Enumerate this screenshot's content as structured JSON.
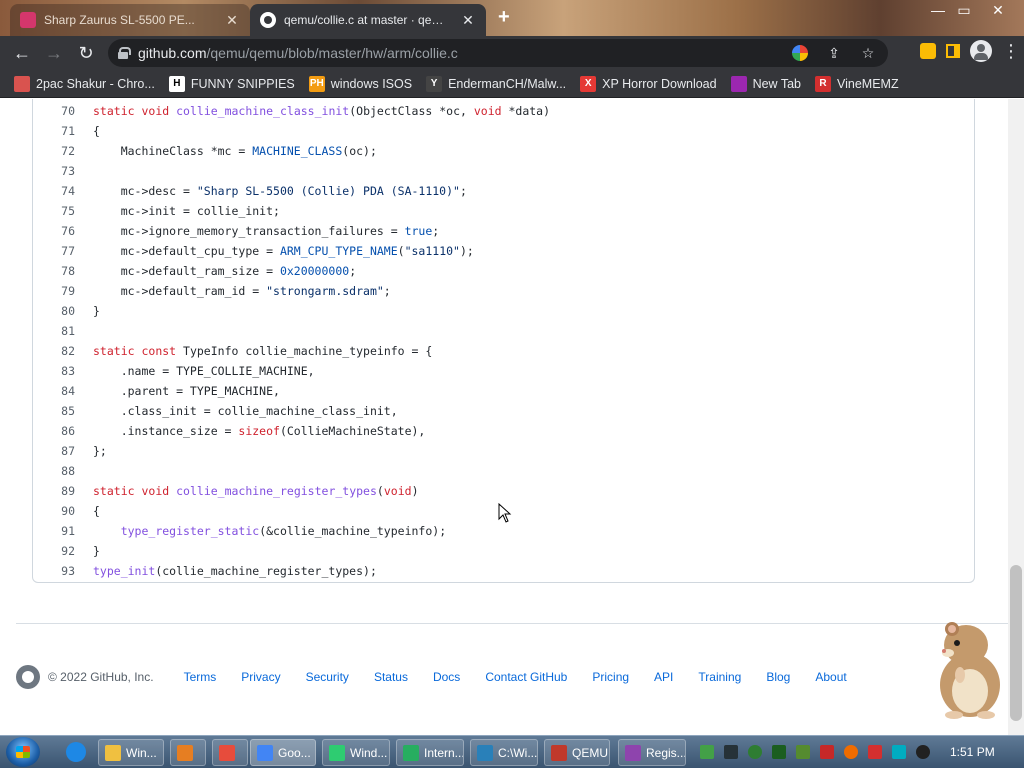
{
  "browser": {
    "tabs": [
      {
        "title": "Sharp Zaurus SL-5500 PE...",
        "active": false
      },
      {
        "title": "qemu/collie.c at master · qemu/q",
        "active": true
      }
    ],
    "new_tab_label": "+",
    "close_glyph": "✕",
    "window_controls": {
      "minimize": "—",
      "maximize": "▭",
      "close": "✕"
    },
    "url": {
      "domain": "github.com",
      "path": "/qemu/qemu/blob/master/hw/arm/collie.c"
    },
    "nav": {
      "back": "←",
      "forward": "→",
      "reload": "↻"
    },
    "bookmarks": [
      {
        "label": "2pac Shakur - Chro...",
        "icon": "page-icon",
        "badge": "",
        "color": "#d9534f"
      },
      {
        "label": "FUNNY SNIPPIES",
        "icon": "h-icon",
        "badge": "H",
        "color": "#ffffff"
      },
      {
        "label": "windows ISOS",
        "icon": "ph-icon",
        "badge": "PH",
        "color": "#f39c12"
      },
      {
        "label": "EndermanCH/Malw...",
        "icon": "yt-icon",
        "badge": "Y",
        "color": "#444444"
      },
      {
        "label": "XP Horror Download",
        "icon": "x-icon",
        "badge": "X",
        "color": "#e53935"
      },
      {
        "label": "New Tab",
        "icon": "globe-icon",
        "badge": "",
        "color": "#9c27b0"
      },
      {
        "label": "VineMEMZ",
        "icon": "r-icon",
        "badge": "R",
        "color": "#d32f2f"
      }
    ]
  },
  "code": {
    "lines": [
      {
        "num": "70",
        "html": "<span class=\"k\">static</span> <span class=\"k\">void</span> <span class=\"f\">collie_machine_class_init</span>(ObjectClass *oc, <span class=\"k\">void</span> *data)"
      },
      {
        "num": "71",
        "html": "{"
      },
      {
        "num": "72",
        "html": "    MachineClass *mc = <span class=\"c\">MACHINE_CLASS</span>(oc);"
      },
      {
        "num": "73",
        "html": ""
      },
      {
        "num": "74",
        "html": "    mc-&gt;desc = <span class=\"s\">\"Sharp SL-5500 (Collie) PDA (SA-1110)\"</span>;"
      },
      {
        "num": "75",
        "html": "    mc-&gt;init = collie_init;"
      },
      {
        "num": "76",
        "html": "    mc-&gt;ignore_memory_transaction_failures = <span class=\"c\">true</span>;"
      },
      {
        "num": "77",
        "html": "    mc-&gt;default_cpu_type = <span class=\"c\">ARM_CPU_TYPE_NAME</span>(<span class=\"s\">\"sa1110\"</span>);"
      },
      {
        "num": "78",
        "html": "    mc-&gt;default_ram_size = <span class=\"c\">0x20000000</span>;"
      },
      {
        "num": "79",
        "html": "    mc-&gt;default_ram_id = <span class=\"s\">\"strongarm.sdram\"</span>;"
      },
      {
        "num": "80",
        "html": "}"
      },
      {
        "num": "81",
        "html": ""
      },
      {
        "num": "82",
        "html": "<span class=\"k\">static</span> <span class=\"k\">const</span> TypeInfo collie_machine_typeinfo = {"
      },
      {
        "num": "83",
        "html": "    .name = TYPE_COLLIE_MACHINE,"
      },
      {
        "num": "84",
        "html": "    .parent = TYPE_MACHINE,"
      },
      {
        "num": "85",
        "html": "    .class_init = collie_machine_class_init,"
      },
      {
        "num": "86",
        "html": "    .instance_size = <span class=\"k\">sizeof</span>(CollieMachineState),"
      },
      {
        "num": "87",
        "html": "};"
      },
      {
        "num": "88",
        "html": ""
      },
      {
        "num": "89",
        "html": "<span class=\"k\">static</span> <span class=\"k\">void</span> <span class=\"f\">collie_machine_register_types</span>(<span class=\"k\">void</span>)"
      },
      {
        "num": "90",
        "html": "{"
      },
      {
        "num": "91",
        "html": "    <span class=\"f\">type_register_static</span>(&amp;collie_machine_typeinfo);"
      },
      {
        "num": "92",
        "html": "}"
      },
      {
        "num": "93",
        "html": "<span class=\"f\">type_init</span>(collie_machine_register_types);"
      }
    ]
  },
  "footer": {
    "copyright": "© 2022 GitHub, Inc.",
    "links": [
      "Terms",
      "Privacy",
      "Security",
      "Status",
      "Docs",
      "Contact GitHub",
      "Pricing",
      "API",
      "Training",
      "Blog",
      "About"
    ]
  },
  "taskbar": {
    "items": [
      {
        "label": "Win...",
        "icon": "folder-icon",
        "color": "#f0c040"
      },
      {
        "label": "",
        "icon": "media-player-icon",
        "color": "#e67e22"
      },
      {
        "label": "",
        "icon": "paint-icon",
        "color": "#e74c3c"
      },
      {
        "label": "Goo...",
        "icon": "chrome-icon",
        "color": "#4285f4"
      },
      {
        "label": "Wind...",
        "icon": "cmd-icon",
        "color": "#2ecc71"
      },
      {
        "label": "Intern...",
        "icon": "network-icon",
        "color": "#27ae60"
      },
      {
        "label": "C:\\Wi...",
        "icon": "powershell-icon",
        "color": "#2980b9"
      },
      {
        "label": "QEMU",
        "icon": "qemu-icon",
        "color": "#c0392b"
      },
      {
        "label": "Regis...",
        "icon": "registry-icon",
        "color": "#8e44ad"
      }
    ],
    "clock": "1:51 PM"
  }
}
